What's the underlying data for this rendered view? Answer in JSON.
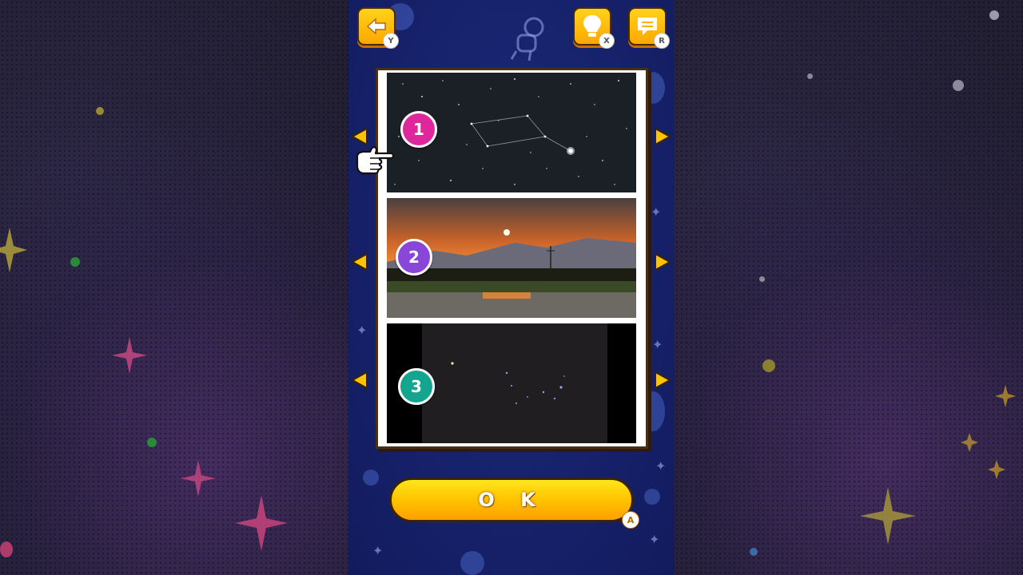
{
  "top_bar": {
    "back_key": "Y",
    "hint_key": "X",
    "menu_key": "R"
  },
  "photos": [
    {
      "number": "1",
      "color": "#e0269b",
      "scene": "starfield-with-constellation"
    },
    {
      "number": "2",
      "color": "#8a45d9",
      "scene": "orange-sunset-over-fields"
    },
    {
      "number": "3",
      "color": "#14a58e",
      "scene": "dark-night-sky-stars"
    }
  ],
  "ok_button": {
    "label": "O K",
    "key": "A"
  },
  "colors": {
    "accent_yellow": "#ffc300",
    "panel_blue": "#16216a",
    "frame_brown": "#4a2e16"
  }
}
